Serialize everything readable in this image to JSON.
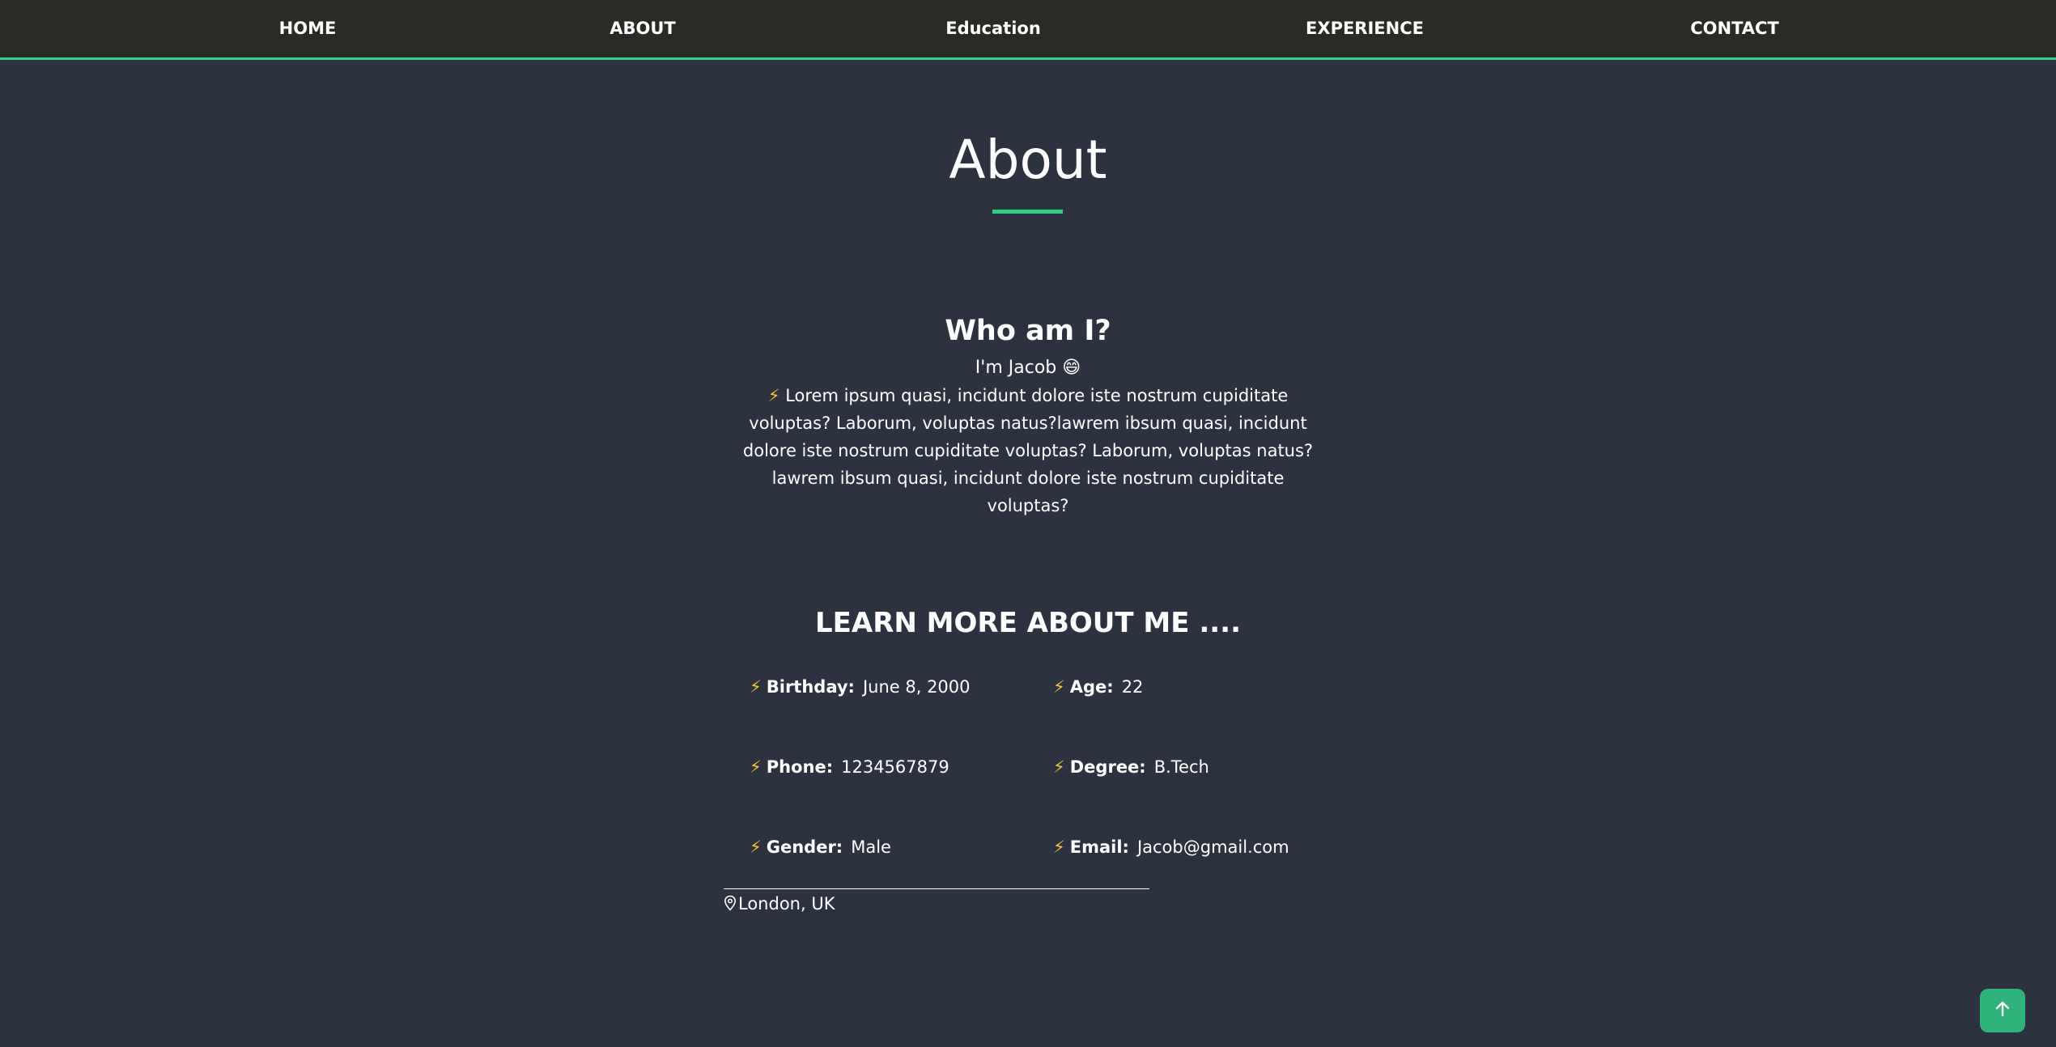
{
  "nav": {
    "items": [
      {
        "label": "HOME"
      },
      {
        "label": "ABOUT"
      },
      {
        "label": "Education"
      },
      {
        "label": "EXPERIENCE"
      },
      {
        "label": "CONTACT"
      }
    ]
  },
  "about": {
    "title": "About"
  },
  "who": {
    "title": "Who am I?",
    "intro": "I'm Jacob 😄",
    "bolt": "⚡",
    "description": "Lorem ipsum quasi, incidunt dolore iste nostrum cupiditate voluptas? Laborum, voluptas natus?lawrem ibsum quasi, incidunt dolore iste nostrum cupiditate voluptas? Laborum, voluptas natus?lawrem ibsum quasi, incidunt dolore iste nostrum cupiditate voluptas?"
  },
  "learn": {
    "title": "LEARN MORE ABOUT ME ....",
    "bolt": "⚡",
    "items": [
      {
        "label": "Birthday:",
        "value": "June 8, 2000"
      },
      {
        "label": "Age:",
        "value": "22"
      },
      {
        "label": "Phone:",
        "value": "1234567879"
      },
      {
        "label": "Degree:",
        "value": "B.Tech"
      },
      {
        "label": "Gender:",
        "value": "Male"
      },
      {
        "label": "Email:",
        "value": "Jacob@gmail.com"
      }
    ]
  },
  "location": {
    "icon": "map-pin-icon",
    "text": "London, UK"
  },
  "back_to_top": {
    "icon": "arrow-up-icon"
  },
  "colors": {
    "background": "#2d3240",
    "navbar": "#292b27",
    "accent": "#2bd283",
    "bolt": "#f4c430",
    "button": "#2fb37a"
  }
}
